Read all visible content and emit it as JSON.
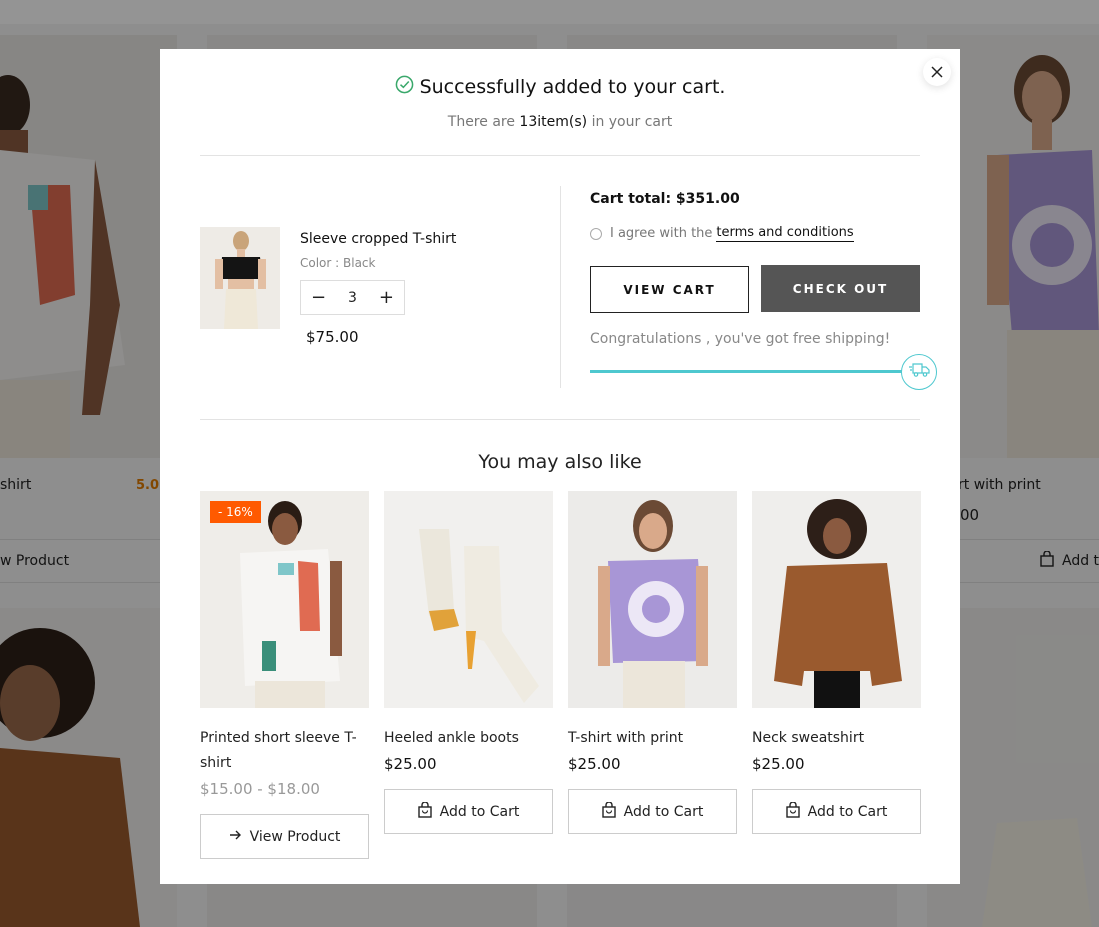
{
  "background": {
    "left_product": {
      "name_fragment": "shirt",
      "rating": "5.0",
      "button_fragment": "w Product"
    },
    "right_product": {
      "name_fragment": "rt with print",
      "price_fragment": "00",
      "button_fragment": "Add t"
    }
  },
  "modal": {
    "title": "Successfully added to your cart.",
    "count_prefix": "There are",
    "count_value": "13",
    "count_unit": "item(s)",
    "count_suffix": "in your cart"
  },
  "cart_item": {
    "name": "Sleeve cropped T-shirt",
    "color": "Color : Black",
    "quantity": "3",
    "price": "$75.00"
  },
  "summary": {
    "total_label": "Cart total: $351.00",
    "agree_text": "I agree with the",
    "terms_link": "terms and conditions",
    "view_cart": "VIEW CART",
    "checkout": "CHECK OUT",
    "free_shipping": "Congratulations , you've got free shipping!",
    "shipping_progress": 1.0,
    "progress_color": "#4ec8cf"
  },
  "recommend": {
    "heading": "You may also like",
    "products": [
      {
        "name": "Printed short sleeve T-shirt",
        "price": "$15.00 - $18.00",
        "badge": "- 16%",
        "button": "View Product"
      },
      {
        "name": "Heeled ankle boots",
        "price": "$25.00",
        "button": "Add to Cart"
      },
      {
        "name": "T-shirt with print",
        "price": "$25.00",
        "button": "Add to Cart"
      },
      {
        "name": "Neck sweatshirt",
        "price": "$25.00",
        "button": "Add to Cart"
      }
    ]
  },
  "colors": {
    "sale_badge": "#ff5a00",
    "checkout_bg": "#555555",
    "success_icon": "#3aa86b"
  }
}
